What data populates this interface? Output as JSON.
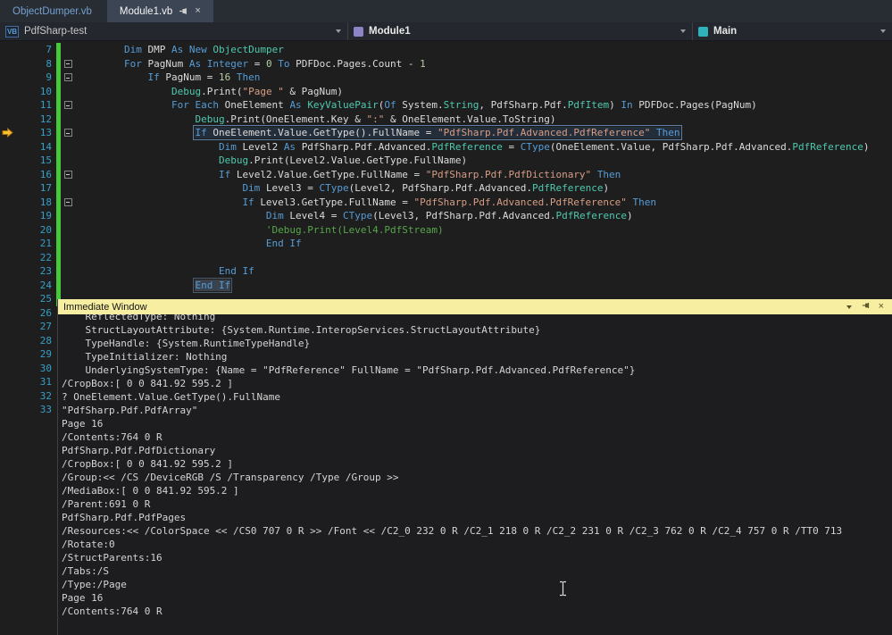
{
  "tab_bar": {
    "tabs": [
      {
        "label": "ObjectDumper.vb",
        "active": false
      },
      {
        "label": "Module1.vb",
        "active": true,
        "pinned": true
      }
    ],
    "close_glyph": "×"
  },
  "nav_bar": {
    "project": {
      "icon_text": "VB",
      "label": "PdfSharp-test"
    },
    "type": {
      "icon": "module-icon",
      "label": "Module1"
    },
    "member": {
      "icon": "method-icon",
      "label": "Main"
    }
  },
  "colors": {
    "tab_active_bg": "#3c4553",
    "change_bar": "#45c93a",
    "line_number": "#36a0c8",
    "immediate_title_bg": "#f7eea1",
    "breakpoint_arrow": "#f5c12c"
  },
  "editor": {
    "token_colors": {
      "kw": "#569cd6",
      "ty": "#4ec9b0",
      "st": "#d69d85",
      "cm": "#57a64a",
      "nu": "#b5cea8",
      "pl": "#dcdcdc"
    },
    "lines": [
      {
        "num": 7,
        "indent": 8,
        "changed": true,
        "tokens": [
          [
            "Dim ",
            "kw"
          ],
          [
            "DMP ",
            "pl"
          ],
          [
            "As ",
            "kw"
          ],
          [
            "New ",
            "kw"
          ],
          [
            "ObjectDumper",
            "ty"
          ]
        ]
      },
      {
        "num": 8,
        "indent": 8,
        "changed": true,
        "fold": true,
        "tokens": [
          [
            "For ",
            "kw"
          ],
          [
            "PagNum ",
            "pl"
          ],
          [
            "As ",
            "kw"
          ],
          [
            "Integer",
            "kw"
          ],
          [
            " = ",
            "pl"
          ],
          [
            "0",
            "nu"
          ],
          [
            " ",
            "pl"
          ],
          [
            "To ",
            "kw"
          ],
          [
            "PDFDoc.Pages.Count - ",
            "pl"
          ],
          [
            "1",
            "nu"
          ]
        ]
      },
      {
        "num": 9,
        "indent": 12,
        "changed": true,
        "fold": true,
        "tokens": [
          [
            "If ",
            "kw"
          ],
          [
            "PagNum = ",
            "pl"
          ],
          [
            "16",
            "nu"
          ],
          [
            " ",
            "pl"
          ],
          [
            "Then",
            "kw"
          ]
        ]
      },
      {
        "num": 10,
        "indent": 16,
        "changed": true,
        "tokens": [
          [
            "Debug",
            "ty"
          ],
          [
            ".Print(",
            "pl"
          ],
          [
            "\"Page \"",
            "st"
          ],
          [
            " & PagNum)",
            "pl"
          ]
        ]
      },
      {
        "num": 11,
        "indent": 16,
        "changed": true,
        "fold": true,
        "tokens": [
          [
            "For Each ",
            "kw"
          ],
          [
            "OneElement ",
            "pl"
          ],
          [
            "As ",
            "kw"
          ],
          [
            "KeyValuePair",
            "ty"
          ],
          [
            "(",
            "pl"
          ],
          [
            "Of ",
            "kw"
          ],
          [
            "System.",
            "pl"
          ],
          [
            "String",
            "ty"
          ],
          [
            ", PdfSharp.Pdf.",
            "pl"
          ],
          [
            "PdfItem",
            "ty"
          ],
          [
            ") ",
            "pl"
          ],
          [
            "In ",
            "kw"
          ],
          [
            "PDFDoc.Pages(PagNum)",
            "pl"
          ]
        ]
      },
      {
        "num": 12,
        "indent": 20,
        "changed": true,
        "tokens": [
          [
            "Debug",
            "ty"
          ],
          [
            ".Print(OneElement.Key & ",
            "pl"
          ],
          [
            "\":\"",
            "st"
          ],
          [
            " & OneElement.Value.ToString)",
            "pl"
          ]
        ]
      },
      {
        "num": 13,
        "indent": 20,
        "changed": true,
        "fold": true,
        "box": true,
        "gutter": "arrow",
        "tokens": [
          [
            "If ",
            "kw"
          ],
          [
            "OneElement.Value.GetType().FullName = ",
            "pl"
          ],
          [
            "\"PdfSharp.Pdf.Advanced.PdfReference\"",
            "st"
          ],
          [
            " ",
            "pl"
          ],
          [
            "Then",
            "kw"
          ]
        ]
      },
      {
        "num": 14,
        "indent": 24,
        "changed": true,
        "tokens": [
          [
            "Dim ",
            "kw"
          ],
          [
            "Level2 ",
            "pl"
          ],
          [
            "As ",
            "kw"
          ],
          [
            "PdfSharp.Pdf.Advanced.",
            "pl"
          ],
          [
            "PdfReference",
            "ty"
          ],
          [
            " = ",
            "pl"
          ],
          [
            "CType",
            "kw"
          ],
          [
            "(OneElement.Value, PdfSharp.Pdf.Advanced.",
            "pl"
          ],
          [
            "PdfReference",
            "ty"
          ],
          [
            ")",
            "pl"
          ]
        ]
      },
      {
        "num": 15,
        "indent": 24,
        "changed": true,
        "tokens": [
          [
            "Debug",
            "ty"
          ],
          [
            ".Print(Level2.Value.GetType.FullName)",
            "pl"
          ]
        ]
      },
      {
        "num": 16,
        "indent": 24,
        "changed": true,
        "fold": true,
        "tokens": [
          [
            "If ",
            "kw"
          ],
          [
            "Level2.Value.GetType.FullName = ",
            "pl"
          ],
          [
            "\"PdfSharp.Pdf.PdfDictionary\"",
            "st"
          ],
          [
            " ",
            "pl"
          ],
          [
            "Then",
            "kw"
          ]
        ]
      },
      {
        "num": 17,
        "indent": 28,
        "changed": true,
        "tokens": [
          [
            "Dim ",
            "kw"
          ],
          [
            "Level3 = ",
            "pl"
          ],
          [
            "CType",
            "kw"
          ],
          [
            "(Level2, PdfSharp.Pdf.Advanced.",
            "pl"
          ],
          [
            "PdfReference",
            "ty"
          ],
          [
            ")",
            "pl"
          ]
        ]
      },
      {
        "num": 18,
        "indent": 28,
        "changed": true,
        "fold": true,
        "tokens": [
          [
            "If ",
            "kw"
          ],
          [
            "Level3.GetType.FullName = ",
            "pl"
          ],
          [
            "\"PdfSharp.Pdf.Advanced.PdfReference\"",
            "st"
          ],
          [
            " ",
            "pl"
          ],
          [
            "Then",
            "kw"
          ]
        ]
      },
      {
        "num": 19,
        "indent": 32,
        "changed": true,
        "tokens": [
          [
            "Dim ",
            "kw"
          ],
          [
            "Level4 = ",
            "pl"
          ],
          [
            "CType",
            "kw"
          ],
          [
            "(Level3, PdfSharp.Pdf.Advanced.",
            "pl"
          ],
          [
            "PdfReference",
            "ty"
          ],
          [
            ")",
            "pl"
          ]
        ]
      },
      {
        "num": 20,
        "indent": 32,
        "changed": true,
        "tokens": [
          [
            "'Debug.Print(Level4.PdfStream)",
            "cm"
          ]
        ]
      },
      {
        "num": 21,
        "indent": 32,
        "changed": true,
        "tokens": [
          [
            "End If",
            "kw"
          ]
        ]
      },
      {
        "num": 22,
        "indent": 0,
        "changed": true,
        "tokens": []
      },
      {
        "num": 23,
        "indent": 24,
        "changed": true,
        "tokens": [
          [
            "End If",
            "kw"
          ]
        ]
      },
      {
        "num": 24,
        "indent": 20,
        "changed": true,
        "match": true,
        "tokens": [
          [
            "End If",
            "kw"
          ]
        ]
      },
      {
        "num": 25,
        "indent": 0,
        "changed": true,
        "tokens": []
      },
      {
        "num": 26,
        "indent": 0,
        "tokens": []
      },
      {
        "num": 27,
        "indent": 0,
        "tokens": []
      },
      {
        "num": 28,
        "indent": 0,
        "tokens": []
      },
      {
        "num": 29,
        "indent": 0,
        "tokens": []
      },
      {
        "num": 30,
        "indent": 0,
        "tokens": []
      },
      {
        "num": 31,
        "indent": 0,
        "tokens": []
      },
      {
        "num": 32,
        "indent": 0,
        "tokens": []
      },
      {
        "num": 33,
        "indent": 0,
        "tokens": []
      }
    ]
  },
  "immediate_window": {
    "title": "Immediate Window",
    "close_glyph": "×",
    "lines": [
      "    ReflectedType: Nothing",
      "    StructLayoutAttribute: {System.Runtime.InteropServices.StructLayoutAttribute}",
      "    TypeHandle: {System.RuntimeTypeHandle}",
      "    TypeInitializer: Nothing",
      "    UnderlyingSystemType: {Name = \"PdfReference\" FullName = \"PdfSharp.Pdf.Advanced.PdfReference\"}",
      "/CropBox:[ 0 0 841.92 595.2 ]",
      "? OneElement.Value.GetType().FullName",
      "\"PdfSharp.Pdf.PdfArray\"",
      "Page 16",
      "/Contents:764 0 R",
      "PdfSharp.Pdf.PdfDictionary",
      "/CropBox:[ 0 0 841.92 595.2 ]",
      "/Group:<< /CS /DeviceRGB /S /Transparency /Type /Group >>",
      "/MediaBox:[ 0 0 841.92 595.2 ]",
      "/Parent:691 0 R",
      "PdfSharp.Pdf.PdfPages",
      "/Resources:<< /ColorSpace << /CS0 707 0 R >> /Font << /C2_0 232 0 R /C2_1 218 0 R /C2_2 231 0 R /C2_3 762 0 R /C2_4 757 0 R /TT0 713",
      "/Rotate:0",
      "/StructParents:16",
      "/Tabs:/S",
      "/Type:/Page",
      "Page 16",
      "/Contents:764 0 R"
    ]
  }
}
